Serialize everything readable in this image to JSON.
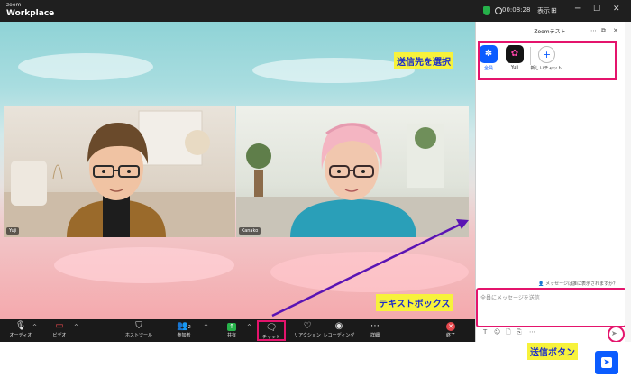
{
  "titlebar": {
    "logo_top": "zoom",
    "logo_bottom": "Workplace",
    "timer": "00:08:28",
    "view_label": "表示",
    "minimize": "─",
    "maximize": "☐",
    "close": "✕"
  },
  "participants": [
    {
      "name": "Yuji"
    },
    {
      "name": "Kanako"
    }
  ],
  "toolbar": {
    "audio": "オーディオ",
    "video": "ビデオ",
    "host_tools": "ホストツール",
    "participants": "参加者",
    "participant_count": "2",
    "share": "共有",
    "chat": "チャット",
    "reactions": "リアクション",
    "recording": "レコーディング",
    "more": "詳細",
    "end": "終了"
  },
  "chat": {
    "title": "Zoomテスト",
    "recipients": [
      {
        "label": "全員"
      },
      {
        "label": "Yuji"
      },
      {
        "label": "新しいチャット"
      }
    ],
    "visibility_note": "メッセージは誰に表示されますか？",
    "input_placeholder": "全員にメッセージを送信"
  },
  "callouts": {
    "recipient": "送信先を選択",
    "textbox": "テキストボックス",
    "send": "送信ボタン"
  },
  "colors": {
    "highlight_border": "#e4146c",
    "callout_bg": "#f7f23b",
    "callout_text": "#1a2ccc",
    "zoom_blue": "#0b5cff",
    "arrow": "#5a14b4"
  }
}
